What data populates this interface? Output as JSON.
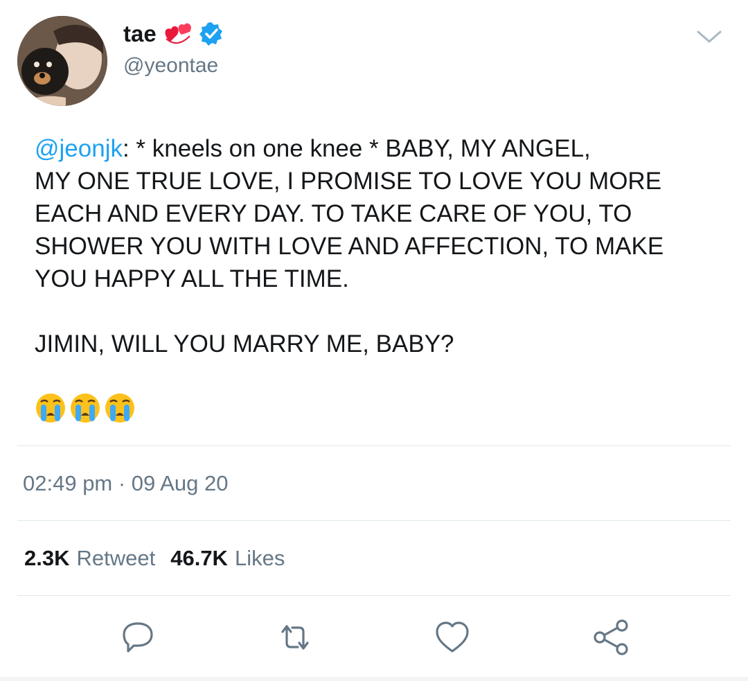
{
  "author": {
    "display_name": "tae",
    "handle": "@yeontae",
    "name_emoji": "revolving-hearts-icon",
    "verified_icon": "verified-badge-icon"
  },
  "tweet": {
    "mention": "@jeonjk",
    "line1_rest": ": * kneels on one knee * BABY, MY ANGEL,",
    "line2": "MY ONE TRUE LOVE, I PROMISE TO LOVE YOU MORE",
    "line3": "EACH AND EVERY DAY. TO TAKE CARE OF YOU, TO",
    "line4": "SHOWER YOU WITH LOVE AND AFFECTION, TO MAKE",
    "line5": "YOU HAPPY ALL THE TIME.",
    "line6": "JIMIN, WILL YOU MARRY ME, BABY?",
    "emojis": [
      "crying-face-icon",
      "crying-face-icon",
      "crying-face-icon"
    ]
  },
  "meta": {
    "timestamp": "02:49 pm · 09 Aug 20"
  },
  "stats": {
    "retweet_count": "2.3K",
    "retweet_label": "Retweet",
    "likes_count": "46.7K",
    "likes_label": "Likes"
  },
  "actions": [
    "reply-icon",
    "retweet-icon",
    "like-icon",
    "share-icon"
  ],
  "colors": {
    "text": "#14171a",
    "secondary": "#657786",
    "accent": "#1da1f2",
    "divider": "#e1e8ed"
  }
}
